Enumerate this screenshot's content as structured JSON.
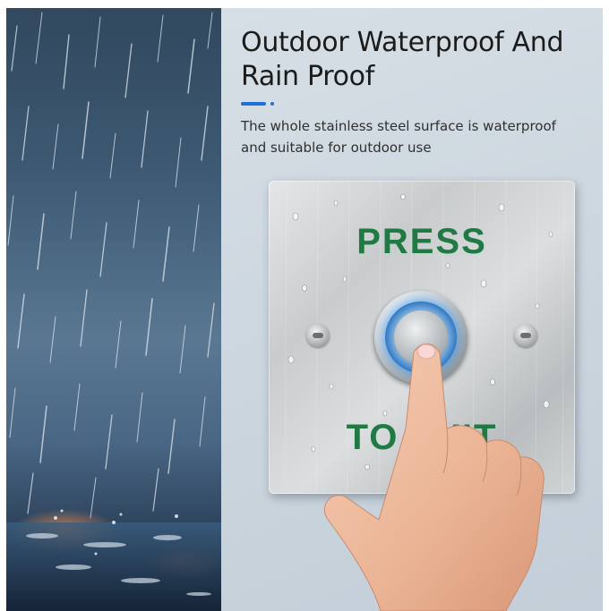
{
  "heading": "Outdoor Waterproof And Rain Proof",
  "description": "The whole stainless steel surface is waterproof and suitable for outdoor use",
  "plate": {
    "top_label": "PRESS",
    "bottom_label": "TO EXIT"
  },
  "colors": {
    "accent": "#1e6fd9",
    "label_green": "#1f7a44",
    "rain_dark": "#2a3f57",
    "button_glow": "#2f7bc9"
  },
  "icons": {
    "rain": "rain-illustration",
    "button": "exit-push-button",
    "hand": "pressing-hand"
  }
}
